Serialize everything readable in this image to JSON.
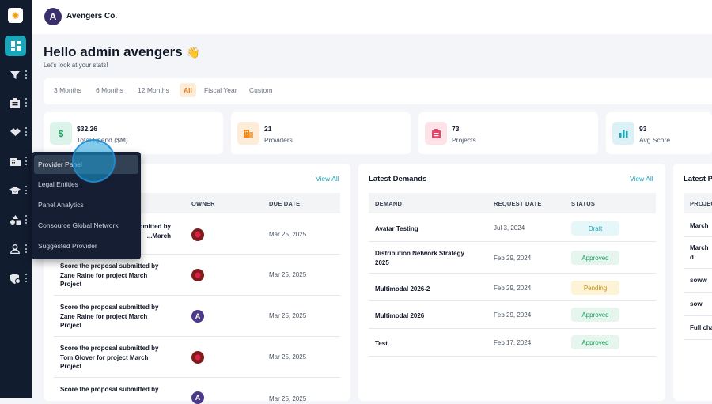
{
  "app": {
    "logo_glyph": "✺",
    "brand_glyph": "A",
    "company_name": "Avengers Co."
  },
  "header": {
    "greeting": "Hello admin avengers",
    "wave": "👋",
    "subtitle": "Let's look at your stats!"
  },
  "filters": {
    "tabs": [
      "3 Months",
      "6 Months",
      "12 Months",
      "All",
      "Fiscal Year",
      "Custom"
    ],
    "active": "All"
  },
  "stats": [
    {
      "value": "$32.26",
      "label": "Total Spend ($M)",
      "icon": "dollar-icon",
      "glyph": "$"
    },
    {
      "value": "21",
      "label": "Providers",
      "icon": "building-icon"
    },
    {
      "value": "73",
      "label": "Projects",
      "icon": "clipboard-icon"
    },
    {
      "value": "93",
      "label": "Avg Score",
      "icon": "bar-chart-icon"
    }
  ],
  "sidebar": {
    "items": [
      "dashboard-icon",
      "filter-icon",
      "clipboard-icon",
      "handshake-icon",
      "building-icon",
      "graduation-cap-icon",
      "shapes-icon",
      "user-icon",
      "shield-gear-icon"
    ]
  },
  "flyout": {
    "items": [
      "Provider Panel",
      "Legal Entities",
      "Panel Analytics",
      "Consource Global Network",
      "Suggested Provider"
    ]
  },
  "tasks": {
    "view_all": "View All",
    "columns": {
      "owner": "OWNER",
      "due": "DUE DATE"
    },
    "rows": [
      {
        "line1": "Score the proposal submitted by",
        "line2": "...March",
        "line3": "",
        "avatar": "red",
        "due": "Mar 25, 2025"
      },
      {
        "line1": "Score the proposal submitted by",
        "line2": "Zane Raine for project March",
        "line3": "Project",
        "avatar": "red",
        "due": "Mar 25, 2025"
      },
      {
        "line1": "Score the proposal submitted by",
        "line2": "Zane Raine for project March",
        "line3": "Project",
        "avatar": "purple",
        "due": "Mar 25, 2025"
      },
      {
        "line1": "Score the proposal submitted by",
        "line2": "Tom Glover for project March",
        "line3": "Project",
        "avatar": "red",
        "due": "Mar 25, 2025"
      },
      {
        "line1": "Score the proposal submitted by",
        "line2": "",
        "line3": "",
        "avatar": "purple",
        "due": "Mar 25, 2025"
      }
    ]
  },
  "demands": {
    "title": "Latest Demands",
    "view_all": "View All",
    "columns": {
      "demand": "DEMAND",
      "date": "REQUEST DATE",
      "status": "STATUS"
    },
    "rows": [
      {
        "name": "Avatar Testing",
        "name2": "",
        "date": "Jul 3, 2024",
        "status": "Draft",
        "kind": "draft"
      },
      {
        "name": "Distribution Network Strategy",
        "name2": "2025",
        "date": "Feb 29, 2024",
        "status": "Approved",
        "kind": "approved"
      },
      {
        "name": "Multimodal 2026-2",
        "name2": "",
        "date": "Feb 29, 2024",
        "status": "Pending",
        "kind": "pending"
      },
      {
        "name": "Multimodal 2026",
        "name2": "",
        "date": "Feb 29, 2024",
        "status": "Approved",
        "kind": "approved"
      },
      {
        "name": "Test",
        "name2": "",
        "date": "Feb 17, 2024",
        "status": "Approved",
        "kind": "approved"
      }
    ]
  },
  "projects": {
    "title": "Latest P",
    "column": "PROJEC",
    "rows": [
      {
        "line1": "March",
        "line2": ""
      },
      {
        "line1": "March",
        "line2": "d"
      },
      {
        "line1": "soww",
        "line2": ""
      },
      {
        "line1": "sow",
        "line2": ""
      },
      {
        "line1": "Full cha",
        "line2": ""
      }
    ]
  },
  "colors": {
    "accent": "#1aa5b8",
    "sidebar": "#111c2e",
    "orange": "#e07a12"
  }
}
